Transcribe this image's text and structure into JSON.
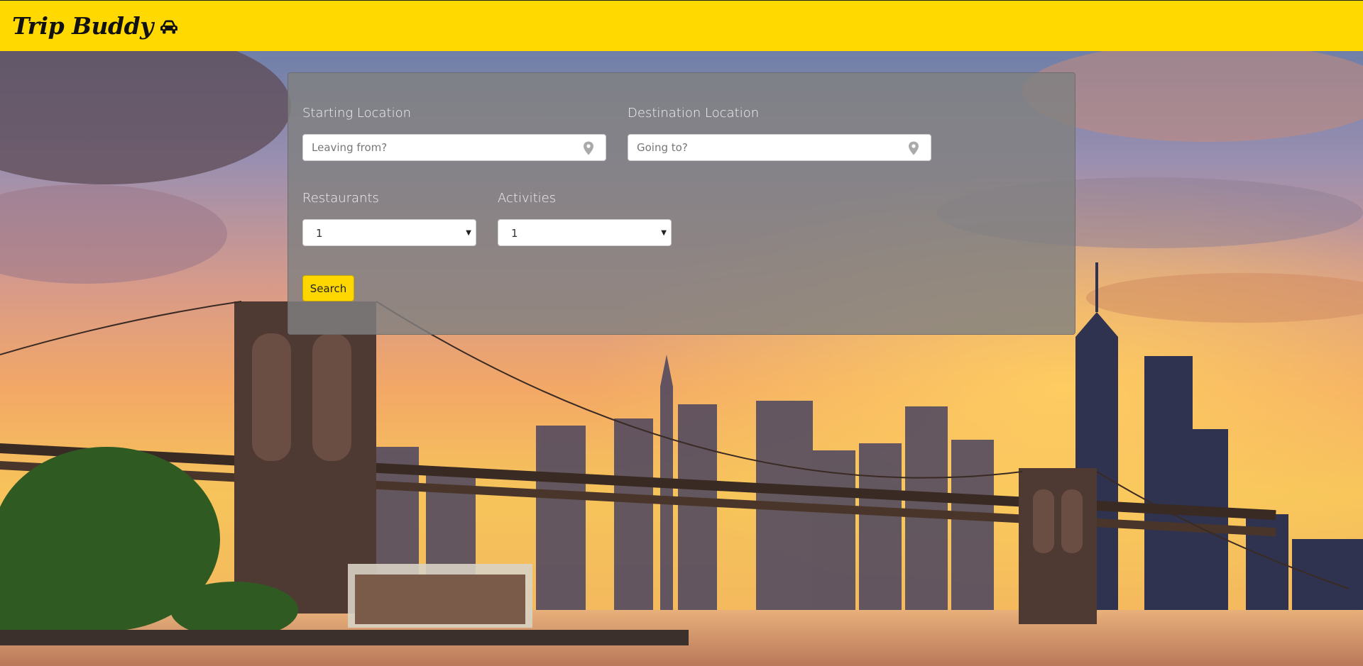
{
  "navbar": {
    "brand": "Trip Buddy",
    "brand_icon": "car-icon",
    "background_color": "#ffd900"
  },
  "search_form": {
    "starting_location": {
      "label": "Starting Location",
      "placeholder": "Leaving from?",
      "value": "",
      "icon": "map-pin-icon"
    },
    "destination_location": {
      "label": "Destination Location",
      "placeholder": "Going to?",
      "value": "",
      "icon": "map-pin-icon"
    },
    "restaurants": {
      "label": "Restaurants",
      "selected": "1"
    },
    "activities": {
      "label": "Activities",
      "selected": "1"
    },
    "search_button_label": "Search",
    "button_color": "#ffd700"
  },
  "background": {
    "scene": "city-skyline-bridge-sunset"
  }
}
